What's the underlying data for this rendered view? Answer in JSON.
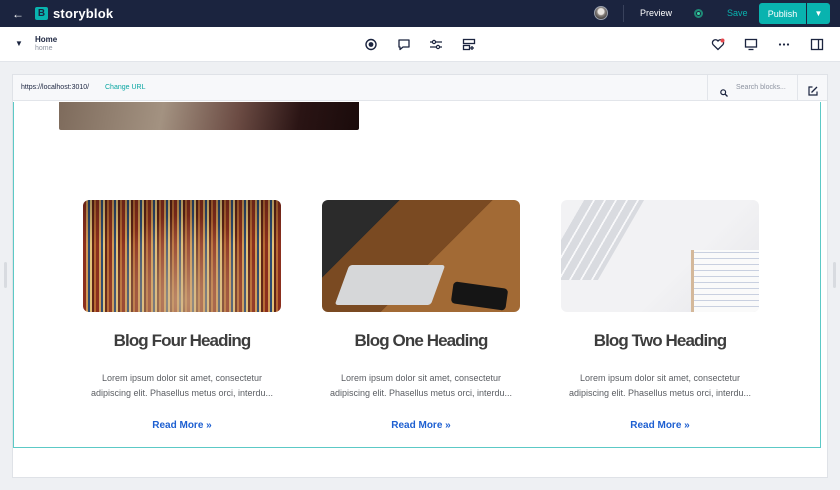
{
  "topbar": {
    "back_icon": "arrow-left-icon",
    "brand": "storyblok",
    "brand_mark": "B",
    "preview_label": "Preview",
    "save_label": "Save",
    "publish_label": "Publish",
    "accent": "#09b3af",
    "background": "#1b243f"
  },
  "breadcrumb": {
    "title": "Home",
    "slug": "home"
  },
  "toolbar": {
    "center_icons": [
      "record-icon",
      "comment-icon",
      "sliders-icon",
      "layout-icon"
    ],
    "right_icons": [
      "heart-icon",
      "monitor-icon",
      "more-icon",
      "sidebar-toggle-icon"
    ]
  },
  "preview": {
    "url": "https://localhost:3010/",
    "change_url_label": "Change URL",
    "search_placeholder": "Search blocks...",
    "frame_border": "#5cc9c6"
  },
  "cards": [
    {
      "image": "library-bookshelves",
      "title": "Blog Four Heading",
      "excerpt": "Lorem ipsum dolor sit amet, consectetur adipiscing elit. Phasellus metus orci, interdu...",
      "link": "Read More »"
    },
    {
      "image": "desk-laptop-coffee",
      "title": "Blog One Heading",
      "excerpt": "Lorem ipsum dolor sit amet, consectetur adipiscing elit. Phasellus metus orci, interdu...",
      "link": "Read More »"
    },
    {
      "image": "keyboard-notebook-pen",
      "title": "Blog Two Heading",
      "excerpt": "Lorem ipsum dolor sit amet, consectetur adipiscing elit. Phasellus metus orci, interdu...",
      "link": "Read More »"
    }
  ],
  "link_color": "#1d5fd1"
}
